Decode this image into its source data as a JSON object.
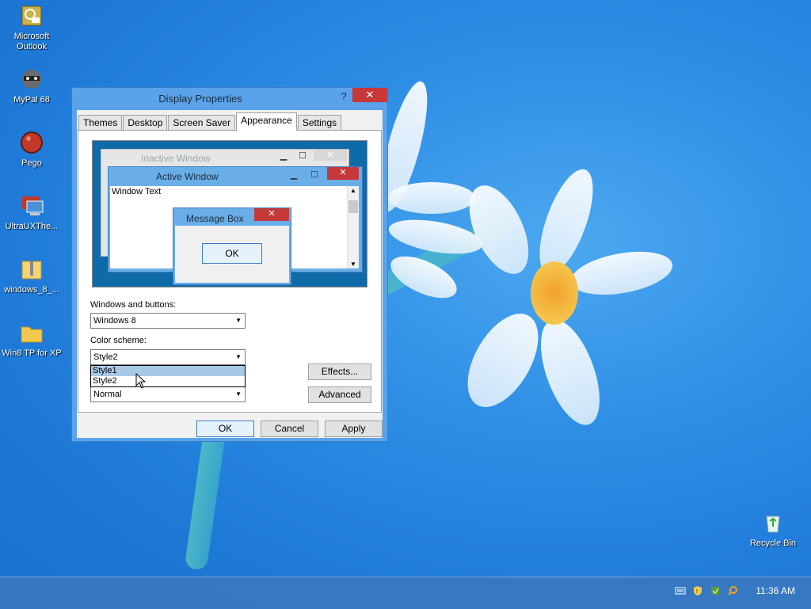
{
  "desktop": {
    "icons": [
      {
        "label": "Microsoft Outlook"
      },
      {
        "label": "MyPal 68"
      },
      {
        "label": "Pego"
      },
      {
        "label": "UltraUXThe..."
      },
      {
        "label": "windows_8_..."
      },
      {
        "label": "Win8 TP for XP"
      },
      {
        "label": "Recycle Bin"
      }
    ]
  },
  "taskbar": {
    "clock": "11:36 AM",
    "tray_icons": [
      "keyboard-icon",
      "shield-icon",
      "network-icon",
      "search-icon"
    ]
  },
  "dialog": {
    "title": "Display Properties",
    "help_label": "?",
    "close_label": "✕",
    "tabs": [
      {
        "label": "Themes",
        "active": false
      },
      {
        "label": "Desktop",
        "active": false
      },
      {
        "label": "Screen Saver",
        "active": false
      },
      {
        "label": "Appearance",
        "active": true
      },
      {
        "label": "Settings",
        "active": false
      }
    ],
    "preview": {
      "inactive_title": "Inactive Window",
      "active_title": "Active Window",
      "window_text": "Window Text",
      "message_box_title": "Message Box",
      "message_box_ok": "OK"
    },
    "windows_buttons_label": "Windows and buttons:",
    "windows_buttons_value": "Windows 8",
    "color_scheme_label": "Color scheme:",
    "color_scheme_value": "Style2",
    "color_scheme_options": [
      "Style1",
      "Style2"
    ],
    "font_size_value": "Normal",
    "effects_button": "Effects...",
    "advanced_button": "Advanced",
    "ok_button": "OK",
    "cancel_button": "Cancel",
    "apply_button": "Apply"
  },
  "colors": {
    "desktop_bg": "#2f8fe6",
    "titlebar": "#5aa3ea",
    "close_red": "#c7383a"
  }
}
